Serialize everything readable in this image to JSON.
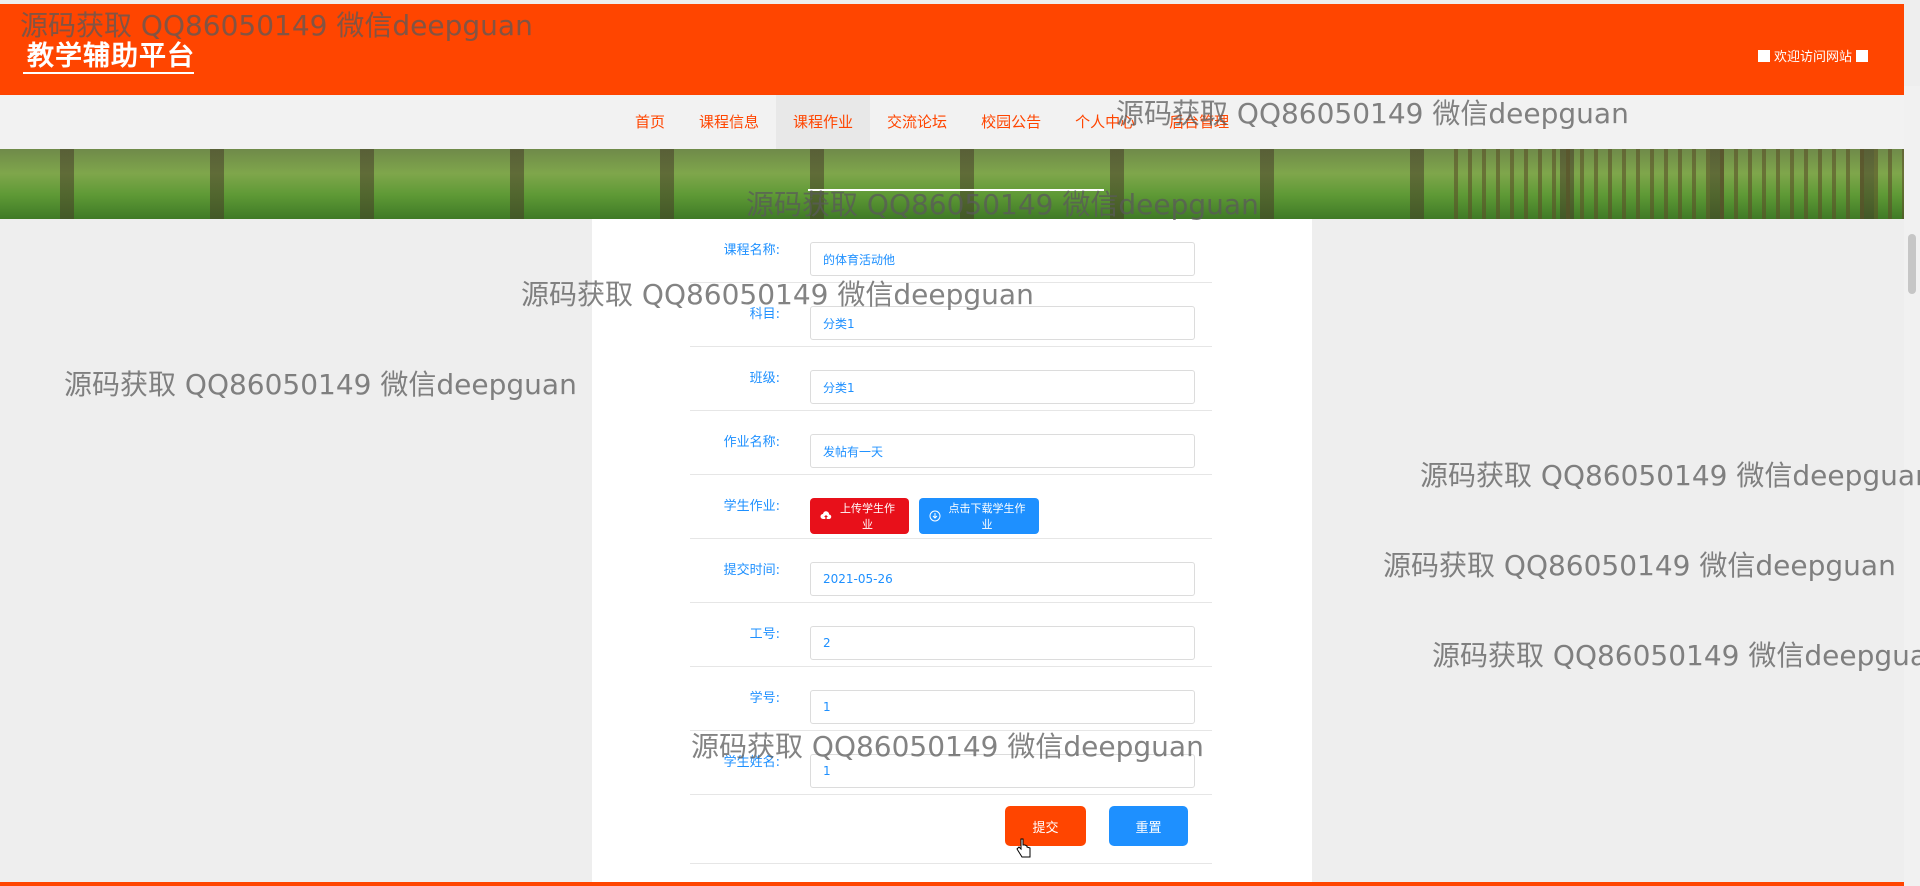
{
  "header": {
    "site_title": "教学辅助平台",
    "welcome_text": "欢迎访问网站"
  },
  "nav": {
    "items": [
      "首页",
      "课程信息",
      "课程作业",
      "交流论坛",
      "校园公告",
      "个人中心",
      "后台管理"
    ],
    "active_index": 2
  },
  "form": {
    "fields": [
      {
        "label": "课程名称:",
        "value": "的体育活动他"
      },
      {
        "label": "科目:",
        "value": "分类1"
      },
      {
        "label": "班级:",
        "value": "分类1"
      },
      {
        "label": "作业名称:",
        "value": "发帖有一天"
      }
    ],
    "student_work": {
      "label": "学生作业:",
      "upload_label": "上传学生作业",
      "download_label": "点击下载学生作业"
    },
    "fields2": [
      {
        "label": "提交时间:",
        "value": "2021-05-26"
      },
      {
        "label": "工号:",
        "value": "2"
      },
      {
        "label": "学号:",
        "value": "1"
      },
      {
        "label": "学生姓名:",
        "value": "1"
      }
    ],
    "submit_label": "提交",
    "reset_label": "重置"
  },
  "watermark": "源码获取 QQ86050149 微信deepguan",
  "colors": {
    "accent": "#ff4500",
    "link": "#1e90ff",
    "upload": "#e8101a"
  }
}
